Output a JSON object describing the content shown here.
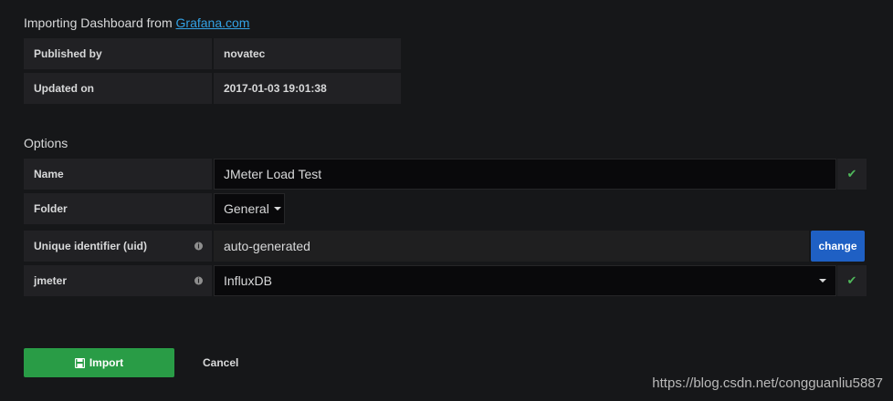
{
  "header": {
    "title_prefix": "Importing Dashboard from",
    "title_link": "Grafana.com"
  },
  "info": {
    "published_label": "Published by",
    "published_value": "novatec",
    "updated_label": "Updated on",
    "updated_value": "2017-01-03 19:01:38"
  },
  "options": {
    "heading": "Options",
    "name_label": "Name",
    "name_value": "JMeter Load Test",
    "folder_label": "Folder",
    "folder_value": "General",
    "uid_label": "Unique identifier (uid)",
    "uid_value": "auto-generated",
    "change_label": "change",
    "datasource_label": "jmeter",
    "datasource_value": "InfluxDB"
  },
  "actions": {
    "import_label": "Import",
    "cancel_label": "Cancel"
  },
  "watermark": "https://blog.csdn.net/congguanliu5887",
  "colors": {
    "background": "#161719",
    "accent_blue": "#1f60c4",
    "success_green": "#299c46",
    "link": "#33a2e5"
  }
}
